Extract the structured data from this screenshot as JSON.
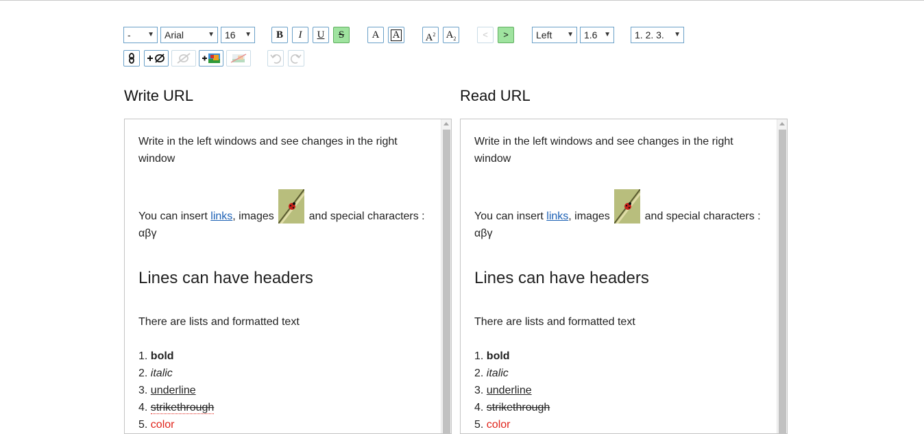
{
  "toolbar": {
    "heading_select": "-",
    "font_select": "Arial",
    "size_select": "16",
    "bold_label": "B",
    "italic_label": "I",
    "underline_label": "U",
    "strike_label": "S",
    "text_color_label": "A",
    "bg_color_label": "A",
    "superscript_label": "A",
    "superscript_mark": "2",
    "subscript_label": "A",
    "subscript_mark": "2",
    "outdent_label": "<",
    "indent_label": ">",
    "align_select": "Left",
    "line_height_select": "1.6",
    "list_select": "1. 2. 3.",
    "active_color": "#9fe39f"
  },
  "write": {
    "title": "Write URL",
    "line1": "Write in the left windows and see changes in the right window",
    "insert_prefix": "You can insert ",
    "insert_link": "links",
    "insert_mid": ", images ",
    "insert_suffix": " and special characters : αβγ",
    "header": "Lines can have headers",
    "lists_intro": "There are lists and formatted text",
    "list": [
      "bold",
      "italic",
      "underline",
      "strikethrough",
      "color"
    ]
  },
  "read": {
    "title": "Read URL",
    "line1": "Write in the left windows and see changes in the right window",
    "insert_prefix": "You can insert ",
    "insert_link": "links",
    "insert_mid": ", images ",
    "insert_suffix": " and special characters : αβγ",
    "header": "Lines can have headers",
    "lists_intro": "There are lists and formatted text",
    "list": [
      "bold",
      "italic",
      "underline",
      "strikethrough",
      "color"
    ]
  },
  "list_numbers": [
    "1.",
    "2.",
    "3.",
    "4.",
    "5."
  ]
}
